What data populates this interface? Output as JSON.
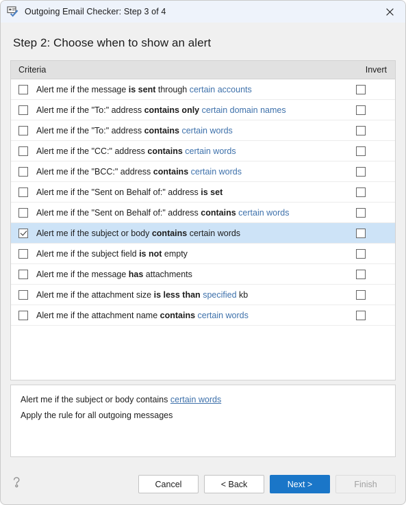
{
  "window": {
    "title": "Outgoing Email Checker: Step 3 of 4",
    "app_icon": "email-check-icon",
    "close_icon": "close-icon",
    "titlebar_color": "#eef3fb",
    "body_color": "#f0f0f0"
  },
  "heading": "Step 2: Choose when to show an alert",
  "list": {
    "headers": {
      "criteria": "Criteria",
      "invert": "Invert"
    },
    "link_color": "#3e71ab",
    "selected_row_color": "#cde3f7",
    "rows": [
      {
        "parts": [
          {
            "t": "Alert me if the message ",
            "s": "plain"
          },
          {
            "t": "is sent",
            "s": "bold"
          },
          {
            "t": " through ",
            "s": "plain"
          },
          {
            "t": "certain accounts",
            "s": "link"
          }
        ],
        "checked": false,
        "invert": false,
        "selected": false
      },
      {
        "parts": [
          {
            "t": "Alert me if the \"To:\" address ",
            "s": "plain"
          },
          {
            "t": "contains only",
            "s": "bold"
          },
          {
            "t": " ",
            "s": "plain"
          },
          {
            "t": "certain domain names",
            "s": "link"
          }
        ],
        "checked": false,
        "invert": false,
        "selected": false
      },
      {
        "parts": [
          {
            "t": "Alert me if the \"To:\" address ",
            "s": "plain"
          },
          {
            "t": "contains",
            "s": "bold"
          },
          {
            "t": " ",
            "s": "plain"
          },
          {
            "t": "certain words",
            "s": "link"
          }
        ],
        "checked": false,
        "invert": false,
        "selected": false
      },
      {
        "parts": [
          {
            "t": "Alert me if the \"CC:\" address ",
            "s": "plain"
          },
          {
            "t": "contains",
            "s": "bold"
          },
          {
            "t": " ",
            "s": "plain"
          },
          {
            "t": "certain words",
            "s": "link"
          }
        ],
        "checked": false,
        "invert": false,
        "selected": false
      },
      {
        "parts": [
          {
            "t": "Alert me if the \"BCC:\" address ",
            "s": "plain"
          },
          {
            "t": "contains",
            "s": "bold"
          },
          {
            "t": " ",
            "s": "plain"
          },
          {
            "t": "certain words",
            "s": "link"
          }
        ],
        "checked": false,
        "invert": false,
        "selected": false
      },
      {
        "parts": [
          {
            "t": "Alert me if the \"Sent on Behalf of:\" address ",
            "s": "plain"
          },
          {
            "t": "is set",
            "s": "bold"
          }
        ],
        "checked": false,
        "invert": false,
        "selected": false
      },
      {
        "parts": [
          {
            "t": "Alert me if the \"Sent on Behalf of:\" address ",
            "s": "plain"
          },
          {
            "t": "contains",
            "s": "bold"
          },
          {
            "t": " ",
            "s": "plain"
          },
          {
            "t": "certain words",
            "s": "link"
          }
        ],
        "checked": false,
        "invert": false,
        "selected": false
      },
      {
        "parts": [
          {
            "t": "Alert me if the subject or body ",
            "s": "plain"
          },
          {
            "t": "contains",
            "s": "bold"
          },
          {
            "t": " certain words",
            "s": "plain"
          }
        ],
        "checked": true,
        "invert": false,
        "selected": true
      },
      {
        "parts": [
          {
            "t": "Alert me if the subject field ",
            "s": "plain"
          },
          {
            "t": "is not",
            "s": "bold"
          },
          {
            "t": " empty",
            "s": "plain"
          }
        ],
        "checked": false,
        "invert": false,
        "selected": false
      },
      {
        "parts": [
          {
            "t": "Alert me if the message ",
            "s": "plain"
          },
          {
            "t": "has",
            "s": "bold"
          },
          {
            "t": " attachments",
            "s": "plain"
          }
        ],
        "checked": false,
        "invert": false,
        "selected": false
      },
      {
        "parts": [
          {
            "t": "Alert me if the attachment size ",
            "s": "plain"
          },
          {
            "t": "is less than",
            "s": "bold"
          },
          {
            "t": " ",
            "s": "plain"
          },
          {
            "t": "specified",
            "s": "link"
          },
          {
            "t": " kb",
            "s": "plain"
          }
        ],
        "checked": false,
        "invert": false,
        "selected": false
      },
      {
        "parts": [
          {
            "t": "Alert me if the attachment name ",
            "s": "plain"
          },
          {
            "t": "contains",
            "s": "bold"
          },
          {
            "t": " ",
            "s": "plain"
          },
          {
            "t": "certain words",
            "s": "link"
          }
        ],
        "checked": false,
        "invert": false,
        "selected": false
      }
    ]
  },
  "summary": {
    "lines": [
      {
        "parts": [
          {
            "t": "Alert me if the subject or body contains ",
            "s": "plain"
          },
          {
            "t": "certain words",
            "s": "link-underline"
          }
        ]
      },
      {
        "parts": [
          {
            "t": "Apply the rule for all outgoing messages",
            "s": "plain"
          }
        ]
      }
    ]
  },
  "footer": {
    "help_icon": "question-mark-help-icon",
    "buttons": [
      {
        "label": "Cancel",
        "style": "normal"
      },
      {
        "label": "< Back",
        "style": "normal"
      },
      {
        "label": "Next >",
        "style": "primary"
      },
      {
        "label": "Finish",
        "style": "disabled"
      }
    ],
    "primary_color": "#1a76c8"
  }
}
